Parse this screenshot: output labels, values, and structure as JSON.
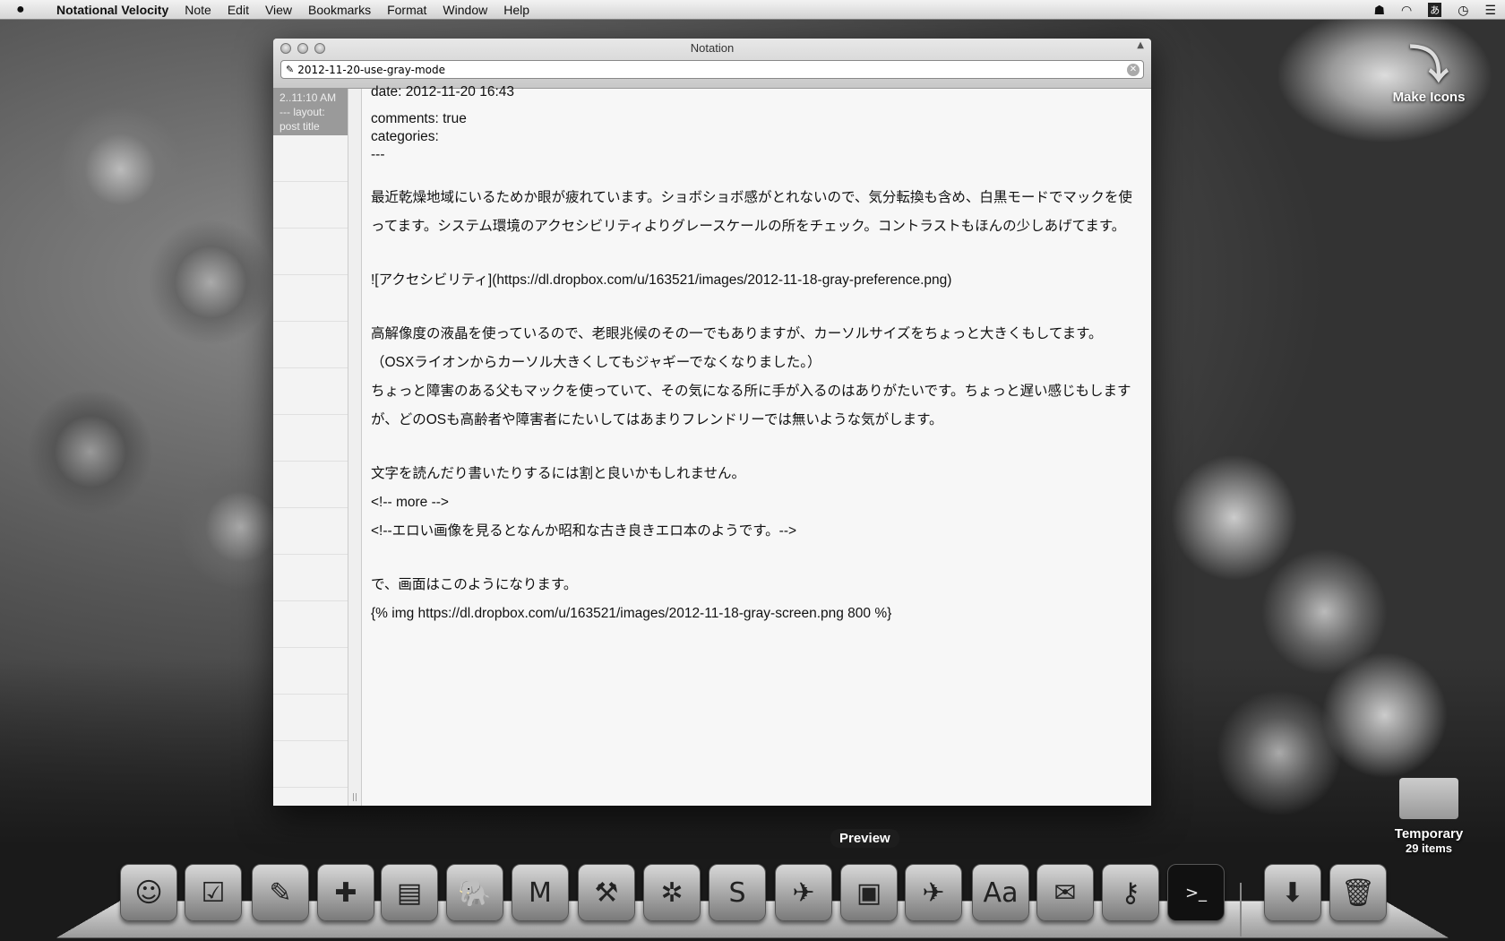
{
  "menubar": {
    "app": "Notational Velocity",
    "items": [
      "Note",
      "Edit",
      "View",
      "Bookmarks",
      "Format",
      "Window",
      "Help"
    ],
    "status_icons": [
      "ghost-icon",
      "wifi-icon",
      "input-method-icon",
      "clock-icon",
      "list-icon"
    ],
    "input_method_glyph": "あ"
  },
  "window": {
    "title": "Notation",
    "search_value": "2012-11-20-use-gray-mode",
    "selected_note": {
      "line1": "2..11:10 AM",
      "line2": "--- layout:",
      "line3": "post title"
    },
    "body": {
      "date": "date: 2012-11-20 16:43",
      "comments": "comments: true",
      "categories": "categories:",
      "sep": "---",
      "p1": "最近乾燥地域にいるためか眼が疲れています。ショボショボ感がとれないので、気分転換も含め、白黒モードでマックを使ってます。システム環境のアクセシビリティよりグレースケールの所をチェック。コントラストもほんの少しあげてます。",
      "p2": "![アクセシビリティ](https://dl.dropbox.com/u/163521/images/2012-11-18-gray-preference.png)",
      "p3a": "高解像度の液晶を使っているので、老眼兆候のその一でもありますが、カーソルサイズをちょっと大きくもしてます。",
      "p3b": "（OSXライオンからカーソル大きくしてもジャギーでなくなりました。）",
      "p3c": "ちょっと障害のある父もマックを使っていて、その気になる所に手が入るのはありがたいです。ちょっと遅い感じもしますが、どのOSも高齢者や障害者にたいしてはあまりフレンドリーでは無いような気がします。",
      "p4a": "文字を読んだり書いたりするには割と良いかもしれません。",
      "p4b": "<!-- more -->",
      "p4c": "<!--エロい画像を見るとなんか昭和な古き良きエロ本のようです。-->",
      "p5a": "で、画面はこのようになります。",
      "p5b": "{% img https://dl.dropbox.com/u/163521/images/2012-11-18-gray-screen.png 800 %}"
    }
  },
  "desktop": {
    "make_icons": "Make Icons",
    "folder_name": "Temporary",
    "folder_count": "29 items"
  },
  "dock": {
    "tooltip": "Preview",
    "icons": [
      "finder-icon",
      "reminders-icon",
      "stickies-icon",
      "puzzle-app-icon",
      "diagram-app-icon",
      "evernote-icon",
      "m-app-icon",
      "xcode-icon",
      "safari-icon",
      "sublime-text-icon",
      "rocket-document-icon",
      "preview-icon",
      "rocket-document-icon",
      "dictionary-icon",
      "mail-icon",
      "keychain-icon",
      "terminal-icon",
      "downloads-folder-icon",
      "trash-icon"
    ],
    "glyphs": [
      "☺",
      "☑",
      "✎",
      "✚",
      "▤",
      "🐘",
      "M",
      "⚒",
      "✲",
      "S",
      "✈",
      "▣",
      "✈",
      "Aa",
      "✉",
      "⚷",
      ">_",
      "⬇",
      "🗑"
    ]
  }
}
